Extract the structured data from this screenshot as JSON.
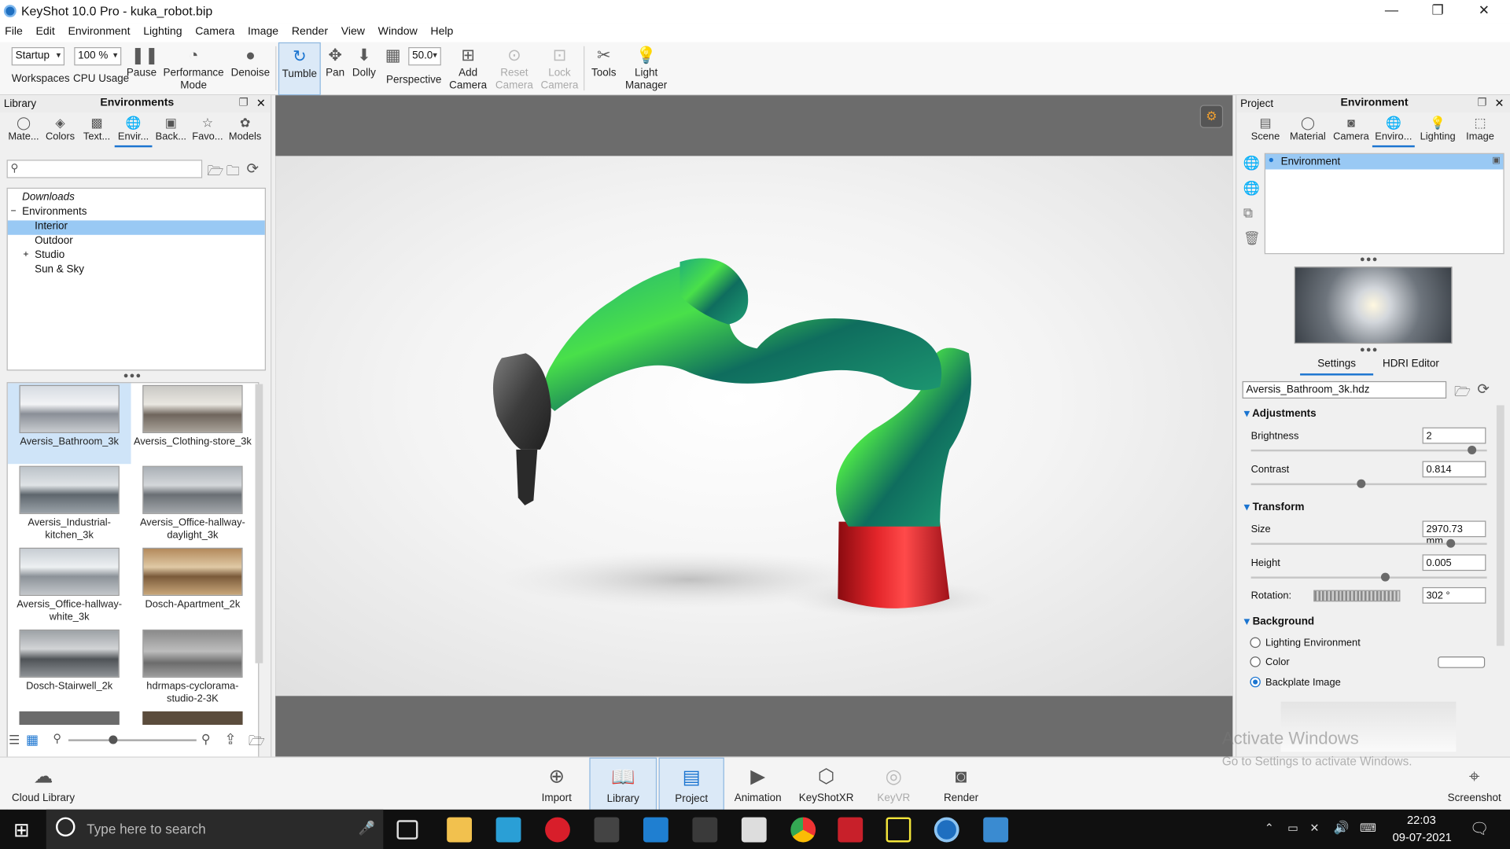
{
  "window": {
    "title": "KeyShot 10.0 Pro  - kuka_robot.bip",
    "minimize": "—",
    "maximize": "❐",
    "close": "✕"
  },
  "menu": [
    "File",
    "Edit",
    "Environment",
    "Lighting",
    "Camera",
    "Image",
    "Render",
    "View",
    "Window",
    "Help"
  ],
  "toolbar": {
    "workspace_value": "Startup",
    "workspace_label": "Workspaces",
    "cpu_value": "100 %",
    "cpu_label": "CPU Usage",
    "pause": "Pause",
    "performance": "Performance\nMode",
    "denoise": "Denoise",
    "tumble": "Tumble",
    "pan": "Pan",
    "dolly": "Dolly",
    "fov_value": "50.0",
    "perspective": "Perspective",
    "add_camera": "Add\nCamera",
    "reset_camera": "Reset\nCamera",
    "lock_camera": "Lock\nCamera",
    "tools": "Tools",
    "light_manager": "Light\nManager"
  },
  "library": {
    "header_left": "Library",
    "header_title": "Environments",
    "tabs": [
      "Mate...",
      "Colors",
      "Text...",
      "Envir...",
      "Back...",
      "Favo...",
      "Models"
    ],
    "tree": [
      {
        "label": "Downloads",
        "indent": 0
      },
      {
        "label": "Environments",
        "indent": 0
      },
      {
        "label": "Interior",
        "indent": 1
      },
      {
        "label": "Outdoor",
        "indent": 1
      },
      {
        "label": "Studio",
        "indent": 1
      },
      {
        "label": "Sun & Sky",
        "indent": 1
      }
    ],
    "thumbnails": [
      "Aversis_Bathroom_3k",
      "Aversis_Clothing-store_3k",
      "Aversis_Industrial-\nkitchen_3k",
      "Aversis_Office-hallway-\ndaylight_3k",
      "Aversis_Office-hallway-\nwhite_3k",
      "Dosch-Apartment_2k",
      "Dosch-Stairwell_2k",
      "hdrmaps-cyclorama-\nstudio-2-3K"
    ]
  },
  "project": {
    "header_left": "Project",
    "header_title": "Environment",
    "tabs": [
      "Scene",
      "Material",
      "Camera",
      "Enviro...",
      "Lighting",
      "Image"
    ],
    "env_list_item": "Environment",
    "subtabs": [
      "Settings",
      "HDRI Editor"
    ],
    "hdri_file": "Aversis_Bathroom_3k.hdz",
    "adjustments": "Adjustments",
    "brightness_label": "Brightness",
    "brightness_value": "2",
    "brightness_fraction": 0.92,
    "contrast_label": "Contrast",
    "contrast_value": "0.814",
    "contrast_fraction": 0.45,
    "transform": "Transform",
    "size_label": "Size",
    "size_value": "2970.73 mm",
    "size_fraction": 0.83,
    "height_label": "Height",
    "height_value": "0.005",
    "height_fraction": 0.55,
    "rotation_label": "Rotation:",
    "rotation_value": "302 °",
    "background": "Background",
    "bg_options": [
      "Lighting Environment",
      "Color",
      "Backplate Image"
    ],
    "bg_selected": "Backplate Image"
  },
  "bottombar": {
    "cloud_library": "Cloud Library",
    "buttons": [
      "Import",
      "Library",
      "Project",
      "Animation",
      "KeyShotXR",
      "KeyVR",
      "Render"
    ],
    "screenshot": "Screenshot"
  },
  "watermark": {
    "line1": "Activate Windows",
    "line2": "Go to Settings to activate Windows."
  },
  "taskbar": {
    "search_placeholder": "Type here to search",
    "time": "22:03",
    "date": "09-07-2021"
  }
}
